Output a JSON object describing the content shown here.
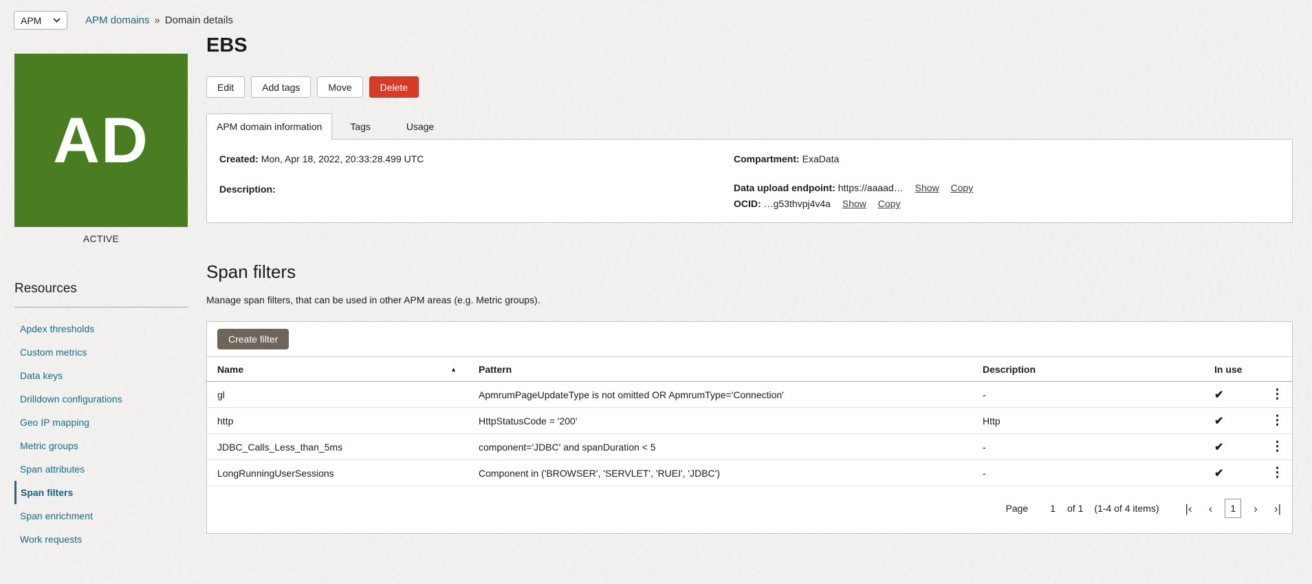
{
  "colors": {
    "avatar_green": "#4a7d22",
    "danger_red": "#d63b25",
    "link_teal": "#1b6a87",
    "create_button_gray": "#6e645a"
  },
  "topbar": {
    "app_selector_value": "APM",
    "breadcrumb": {
      "link": "APM domains",
      "separator": "»",
      "current": "Domain details"
    }
  },
  "sidebar": {
    "avatar_initials": "AD",
    "status": "ACTIVE",
    "resources_heading": "Resources",
    "items": [
      {
        "label": "Apdex thresholds",
        "active": false
      },
      {
        "label": "Custom metrics",
        "active": false
      },
      {
        "label": "Data keys",
        "active": false
      },
      {
        "label": "Drilldown configurations",
        "active": false
      },
      {
        "label": "Geo IP mapping",
        "active": false
      },
      {
        "label": "Metric groups",
        "active": false
      },
      {
        "label": "Span attributes",
        "active": false
      },
      {
        "label": "Span filters",
        "active": true
      },
      {
        "label": "Span enrichment",
        "active": false
      },
      {
        "label": "Work requests",
        "active": false
      }
    ]
  },
  "header": {
    "title": "EBS",
    "actions": {
      "edit": "Edit",
      "add_tags": "Add tags",
      "move": "Move",
      "delete": "Delete"
    }
  },
  "tabs": {
    "active": "APM domain information",
    "tags": "Tags",
    "usage": "Usage"
  },
  "domain_info": {
    "created_label": "Created:",
    "created_value": "Mon, Apr 18, 2022, 20:33:28.499 UTC",
    "description_label": "Description:",
    "description_value": "",
    "compartment_label": "Compartment:",
    "compartment_value": "ExaData",
    "endpoint_label": "Data upload endpoint:",
    "endpoint_value": "https://aaaad…",
    "ocid_label": "OCID:",
    "ocid_value": "…g53thvpj4v4a",
    "show_label": "Show",
    "copy_label": "Copy"
  },
  "span_filters": {
    "heading": "Span filters",
    "description": "Manage span filters, that can be used in other APM areas (e.g. Metric groups).",
    "create_button": "Create filter",
    "table": {
      "columns": {
        "name": "Name",
        "pattern": "Pattern",
        "description": "Description",
        "in_use": "In use"
      },
      "sort_icon": "▲",
      "check_icon": "✔",
      "kebab_icon": "⋮",
      "rows": [
        {
          "name": "gl",
          "pattern": "ApmrumPageUpdateType is not omitted OR ApmrumType='Connection'",
          "description": "-",
          "in_use": true
        },
        {
          "name": "http",
          "pattern": "HttpStatusCode = '200'",
          "description": "Http",
          "in_use": true
        },
        {
          "name": "JDBC_Calls_Less_than_5ms",
          "pattern": "component='JDBC' and spanDuration < 5",
          "description": "-",
          "in_use": true
        },
        {
          "name": "LongRunningUserSessions",
          "pattern": "Component in ('BROWSER', 'SERVLET', 'RUEI', 'JDBC')",
          "description": "-",
          "in_use": true
        }
      ]
    },
    "pagination": {
      "page_label": "Page",
      "page_number": "1",
      "of_label": "of 1",
      "items_label": "(1-4 of 4 items)",
      "current_page": "1",
      "first_icon": "|‹",
      "prev_icon": "‹",
      "next_icon": "›",
      "last_icon": "›|"
    }
  }
}
